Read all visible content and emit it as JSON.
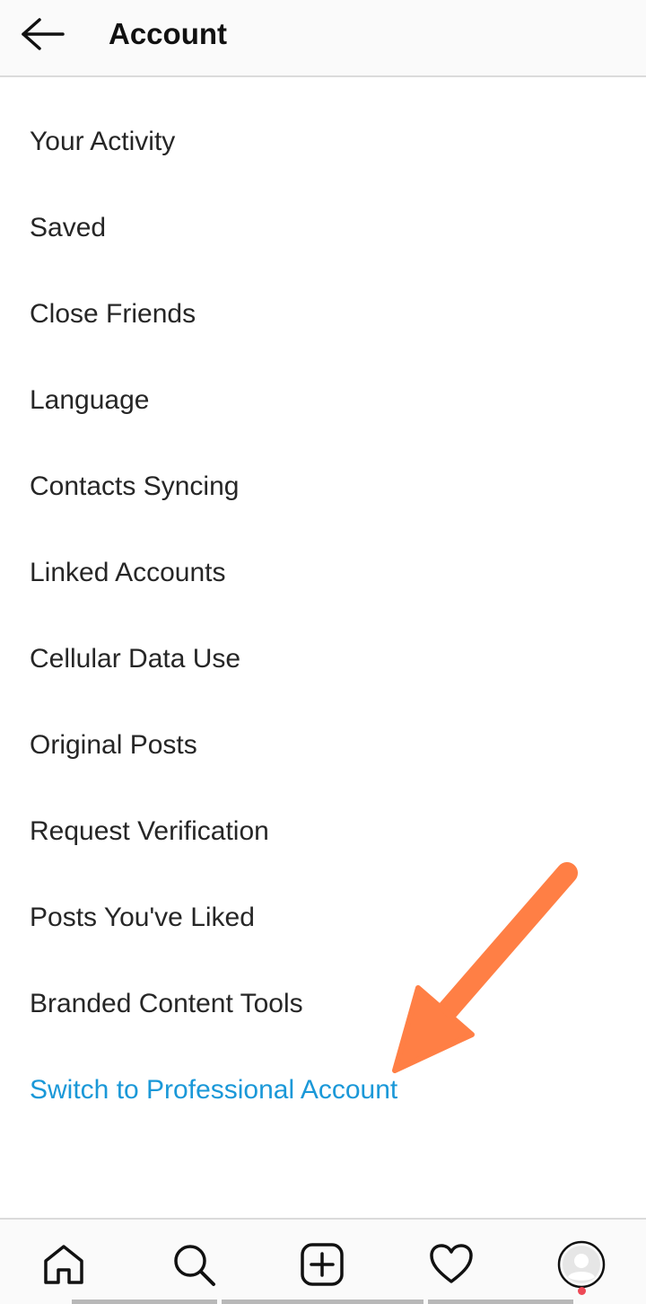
{
  "header": {
    "title": "Account",
    "back_icon": "arrow-left-icon"
  },
  "menu": {
    "items": [
      {
        "label": "Your Activity"
      },
      {
        "label": "Saved"
      },
      {
        "label": "Close Friends"
      },
      {
        "label": "Language"
      },
      {
        "label": "Contacts Syncing"
      },
      {
        "label": "Linked Accounts"
      },
      {
        "label": "Cellular Data Use"
      },
      {
        "label": "Original Posts"
      },
      {
        "label": "Request Verification"
      },
      {
        "label": "Posts You've Liked"
      },
      {
        "label": "Branded Content Tools"
      },
      {
        "label": "Switch to Professional Account"
      }
    ]
  },
  "annotation": {
    "icon": "orange-arrow-annotation",
    "color": "#ff7f45"
  },
  "bottom_nav": {
    "items": [
      {
        "icon": "home-icon"
      },
      {
        "icon": "search-icon"
      },
      {
        "icon": "add-post-icon"
      },
      {
        "icon": "heart-icon"
      },
      {
        "icon": "profile-avatar-icon"
      }
    ],
    "notification_dot_color": "#ed4956"
  },
  "colors": {
    "text": "#262626",
    "accent": "#1a98d8",
    "bar_background": "#fafafa",
    "divider": "#dbdbdb"
  }
}
